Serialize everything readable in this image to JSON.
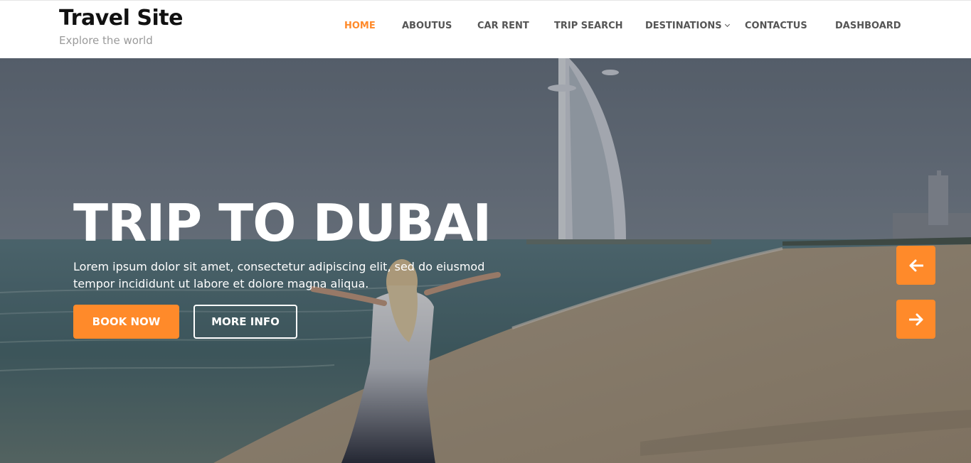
{
  "brand": {
    "title": "Travel Site",
    "tagline": "Explore the world"
  },
  "nav": {
    "items": [
      {
        "label": "HOME",
        "active": true
      },
      {
        "label": "ABOUTUS"
      },
      {
        "label": "CAR RENT"
      },
      {
        "label": "TRIP SEARCH"
      },
      {
        "label": "DESTINATIONS",
        "dropdown": true
      },
      {
        "label": "CONTACTUS"
      },
      {
        "label": "DASHBOARD"
      }
    ]
  },
  "hero": {
    "title": "TRIP TO DUBAI",
    "description": "Lorem ipsum dolor sit amet, consectetur adipiscing elit, sed do eiusmod tempor incididunt ut labore et dolore magna aliqua.",
    "primary_button": "BOOK NOW",
    "secondary_button": "MORE INFO",
    "prev_icon": "arrow-left-icon",
    "next_icon": "arrow-right-icon"
  },
  "colors": {
    "accent": "#ff8a2a",
    "nav_text": "#555555",
    "tagline": "#9a9a9a"
  }
}
